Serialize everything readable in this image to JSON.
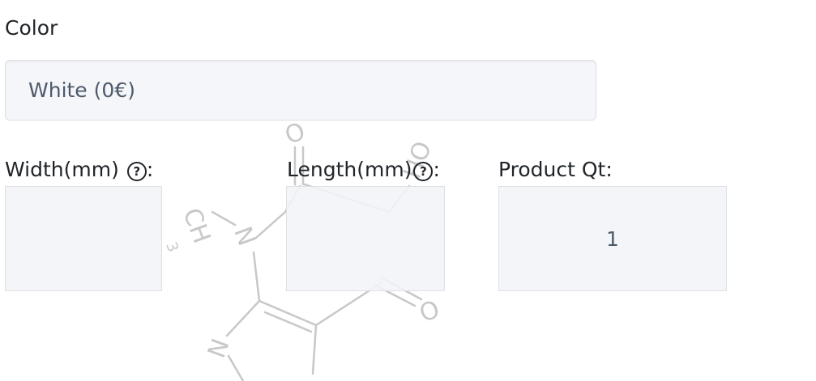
{
  "color_field": {
    "label": "Color",
    "selected_value": "White (0€)"
  },
  "width_field": {
    "label": "Width(mm)",
    "help_icon": "question-circle-icon",
    "colon": ":",
    "value": ""
  },
  "length_field": {
    "label": "Length(mm)",
    "help_icon": "question-circle-icon",
    "colon": ":",
    "value": ""
  },
  "quantity_field": {
    "label": "Product Qt:",
    "value": "1"
  },
  "watermark": {
    "atom_o_top": "O",
    "atom_ch3": "CH",
    "atom_ch3_sub": "3",
    "atom_oh": "OH",
    "atom_n_middle": "N",
    "atom_n_bottom": "N",
    "atom_o_right": "O"
  }
}
